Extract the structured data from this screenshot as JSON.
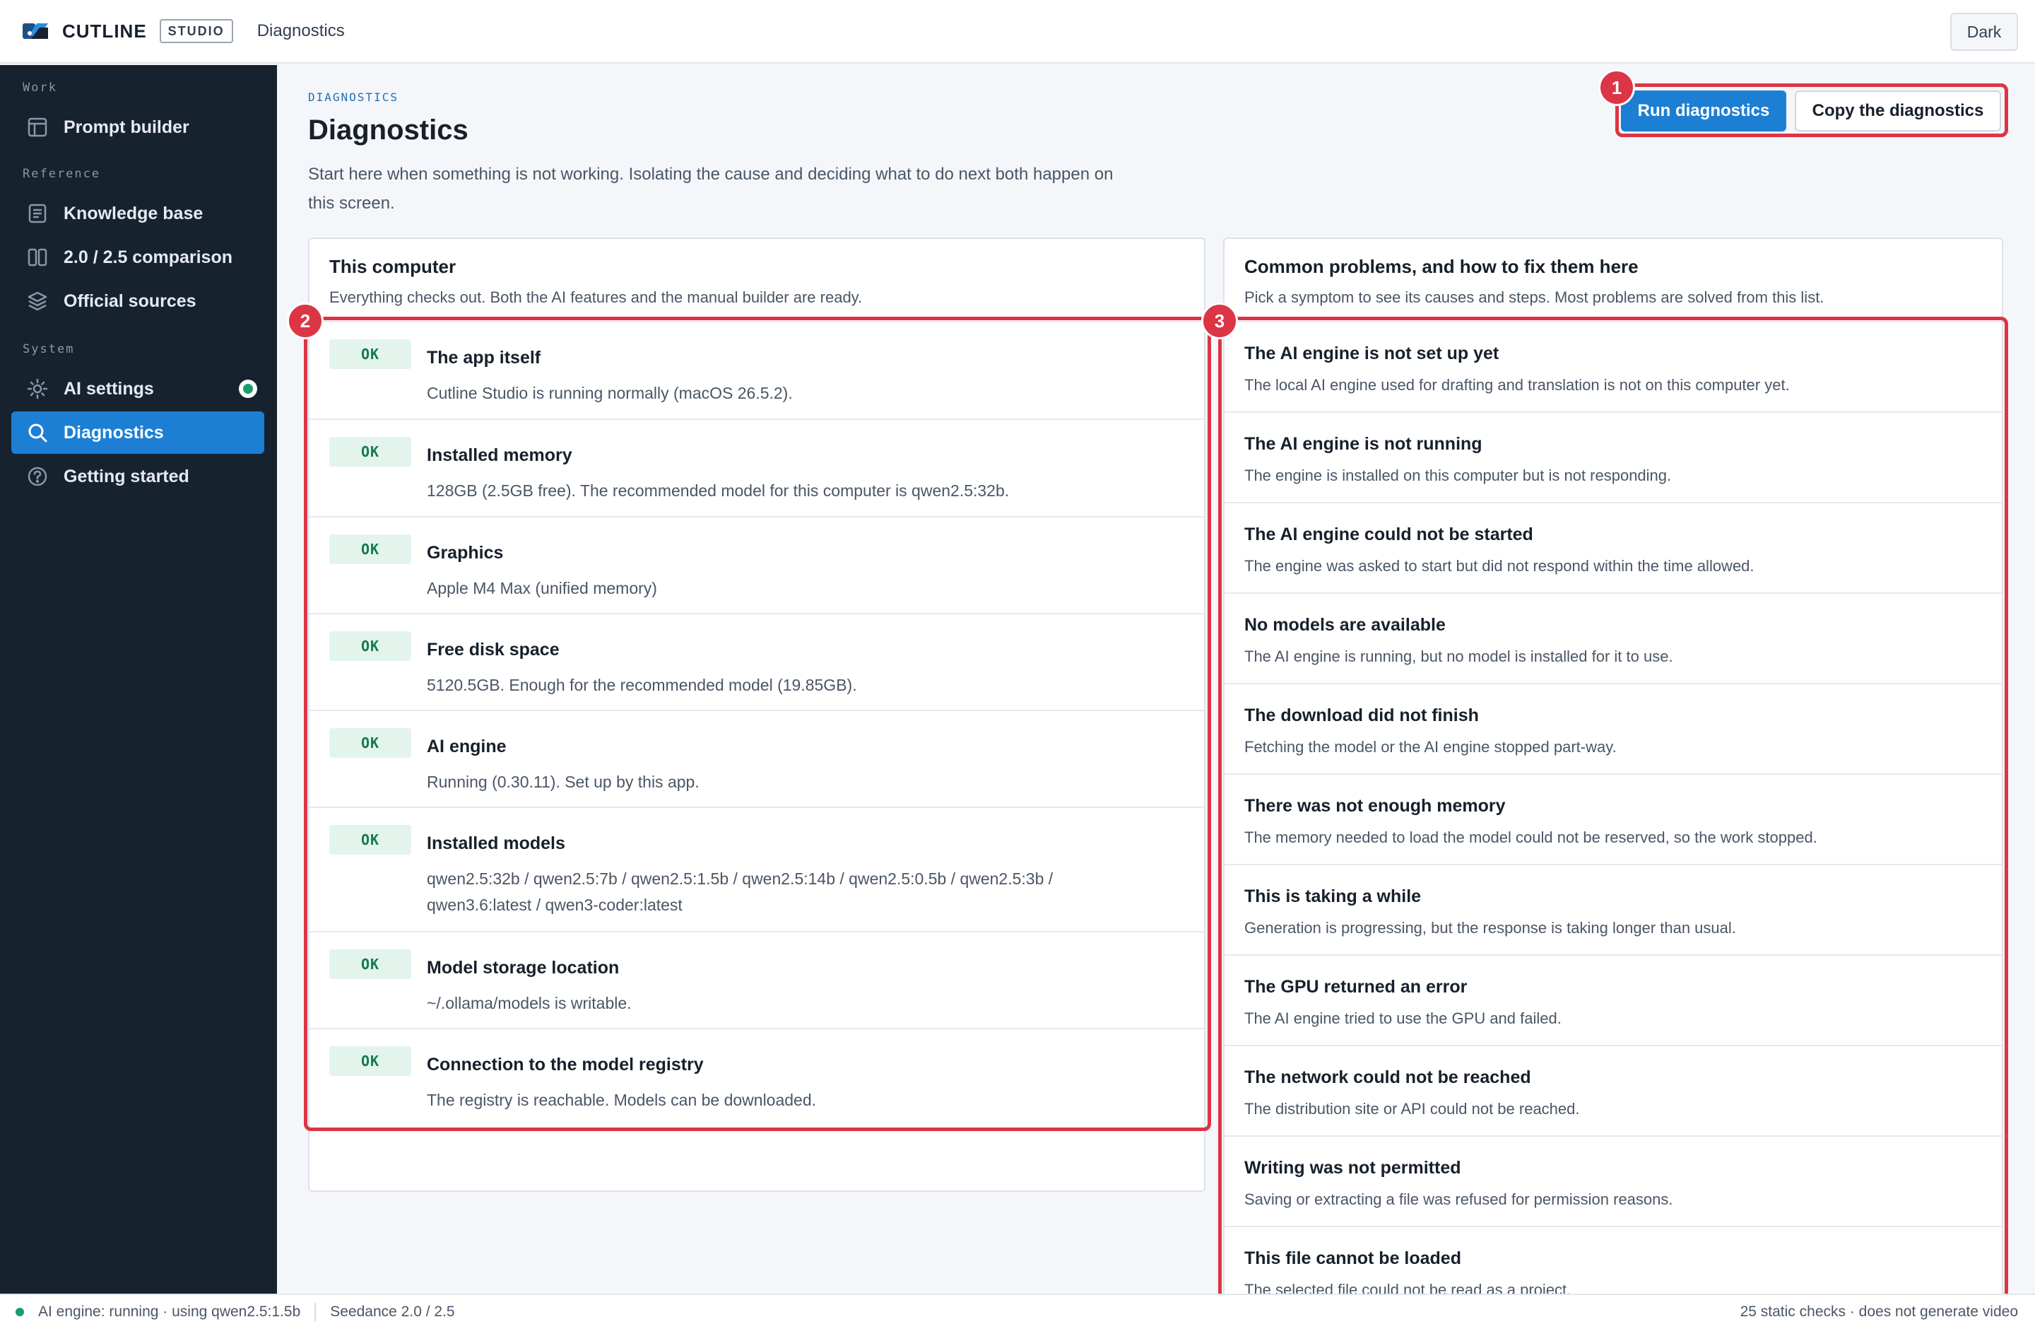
{
  "header": {
    "brand": "CUTLINE",
    "badge": "STUDIO",
    "title": "Diagnostics",
    "theme_button": "Dark"
  },
  "sidebar": {
    "sections": {
      "work": "Work",
      "reference": "Reference",
      "system": "System"
    },
    "items": [
      {
        "label": "Prompt builder",
        "icon": "layout-icon"
      },
      {
        "label": "Knowledge base",
        "icon": "document-icon"
      },
      {
        "label": "2.0 / 2.5 comparison",
        "icon": "columns-icon"
      },
      {
        "label": "Official sources",
        "icon": "layers-icon"
      },
      {
        "label": "AI settings",
        "icon": "sun-icon",
        "status": "active"
      },
      {
        "label": "Diagnostics",
        "icon": "search-icon",
        "selected": true
      },
      {
        "label": "Getting started",
        "icon": "help-icon"
      }
    ]
  },
  "main": {
    "eyebrow": "DIAGNOSTICS",
    "title": "Diagnostics",
    "description": "Start here when something is not working. Isolating the cause and deciding what to do next both happen on this screen.",
    "run_button": "Run diagnostics",
    "copy_button": "Copy the diagnostics"
  },
  "computer_panel": {
    "title": "This computer",
    "subtitle": "Everything checks out. Both the AI features and the manual builder are ready.",
    "checks": [
      {
        "status": "OK",
        "title": "The app itself",
        "desc": "Cutline Studio is running normally (macOS 26.5.2)."
      },
      {
        "status": "OK",
        "title": "Installed memory",
        "desc": "128GB (2.5GB free). The recommended model for this computer is qwen2.5:32b."
      },
      {
        "status": "OK",
        "title": "Graphics",
        "desc": "Apple M4 Max (unified memory)"
      },
      {
        "status": "OK",
        "title": "Free disk space",
        "desc": "5120.5GB. Enough for the recommended model (19.85GB)."
      },
      {
        "status": "OK",
        "title": "AI engine",
        "desc": "Running (0.30.11). Set up by this app."
      },
      {
        "status": "OK",
        "title": "Installed models",
        "desc": "qwen2.5:32b / qwen2.5:7b / qwen2.5:1.5b / qwen2.5:14b / qwen2.5:0.5b / qwen2.5:3b / qwen3.6:latest / qwen3-coder:latest"
      },
      {
        "status": "OK",
        "title": "Model storage location",
        "desc": "~/.ollama/models is writable."
      },
      {
        "status": "OK",
        "title": "Connection to the model registry",
        "desc": "The registry is reachable. Models can be downloaded."
      }
    ]
  },
  "problems_panel": {
    "title": "Common problems, and how to fix them here",
    "subtitle": "Pick a symptom to see its causes and steps. Most problems are solved from this list.",
    "items": [
      {
        "title": "The AI engine is not set up yet",
        "desc": "The local AI engine used for drafting and translation is not on this computer yet."
      },
      {
        "title": "The AI engine is not running",
        "desc": "The engine is installed on this computer but is not responding."
      },
      {
        "title": "The AI engine could not be started",
        "desc": "The engine was asked to start but did not respond within the time allowed."
      },
      {
        "title": "No models are available",
        "desc": "The AI engine is running, but no model is installed for it to use."
      },
      {
        "title": "The download did not finish",
        "desc": "Fetching the model or the AI engine stopped part-way."
      },
      {
        "title": "There was not enough memory",
        "desc": "The memory needed to load the model could not be reserved, so the work stopped."
      },
      {
        "title": "This is taking a while",
        "desc": "Generation is progressing, but the response is taking longer than usual."
      },
      {
        "title": "The GPU returned an error",
        "desc": "The AI engine tried to use the GPU and failed."
      },
      {
        "title": "The network could not be reached",
        "desc": "The distribution site or API could not be reached."
      },
      {
        "title": "Writing was not permitted",
        "desc": "Saving or extracting a file was refused for permission reasons."
      },
      {
        "title": "This file cannot be loaded",
        "desc": "The selected file could not be read as a project."
      }
    ]
  },
  "annotations": [
    "1",
    "2",
    "3"
  ],
  "statusbar": {
    "engine": "AI engine: running · using qwen2.5:1.5b",
    "version": "Seedance 2.0 / 2.5",
    "right": "25 static checks · does not generate video"
  },
  "colors": {
    "accent": "#1c7fd4",
    "sidebar_bg": "#17222f",
    "ok_bg": "#e3f4ec",
    "ok_text": "#147a50",
    "annotation": "#dc3545",
    "status_ok": "#1a9c6c"
  }
}
